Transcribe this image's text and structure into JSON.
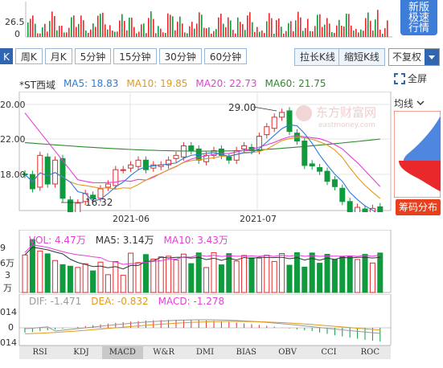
{
  "top_volume": {
    "labels": [
      "26.5",
      "0"
    ]
  },
  "new_window_button": {
    "lines": [
      "新版",
      "极速",
      "行情"
    ]
  },
  "period_tabs": [
    {
      "label": "K"
    },
    {
      "label": "周K"
    },
    {
      "label": "月K"
    },
    {
      "label": "5分钟"
    },
    {
      "label": "15分钟"
    },
    {
      "label": "30分钟"
    },
    {
      "label": "60分钟"
    }
  ],
  "toolbar": {
    "zoom_in": "拉长K线",
    "zoom_out": "缩短K线",
    "adjust": "不复权"
  },
  "legend": {
    "name": "*ST西域",
    "ma5": "MA5: 18.83",
    "ma10": "MA10: 19.85",
    "ma20": "MA20: 22.73",
    "ma60": "MA60: 21.75"
  },
  "colors": {
    "ma5": "#2e7bd8",
    "ma10": "#e19a1a",
    "ma20": "#e43fd6",
    "ma60": "#2f8a2f",
    "up": "#e8282b",
    "down": "#0f9a3d",
    "accent": "#3066b1"
  },
  "fullscreen_label": "全屏",
  "avg_line_label": "均线",
  "chip_label": "筹码分布",
  "watermark": {
    "cn": "东方财富网",
    "en": "eastmoney.com"
  },
  "price_axis": {
    "labels": [
      "20.00",
      "22.00",
      "18.00"
    ]
  },
  "annotations": {
    "high": "29.00",
    "low": "16.32"
  },
  "date_axis": [
    "2021-06",
    "2021-07"
  ],
  "volume_legend": {
    "vol": "VOL: 4.47万",
    "ma5": "MA5: 3.14万",
    "ma10": "MA10: 3.43万"
  },
  "volume_axis": [
    "9",
    "6万",
    "3",
    "万"
  ],
  "macd_legend": {
    "dif": "DIF: -1.471",
    "dea": "DEA: -0.832",
    "macd": "MACD: -1.278"
  },
  "macd_axis": [
    "014",
    "0",
    "014"
  ],
  "indicator_tabs": [
    {
      "label": "RSI"
    },
    {
      "label": "KDJ"
    },
    {
      "label": "MACD"
    },
    {
      "label": "W&R"
    },
    {
      "label": "DMI"
    },
    {
      "label": "BIAS"
    },
    {
      "label": "OBV"
    },
    {
      "label": "CCI"
    },
    {
      "label": "ROC"
    }
  ]
}
